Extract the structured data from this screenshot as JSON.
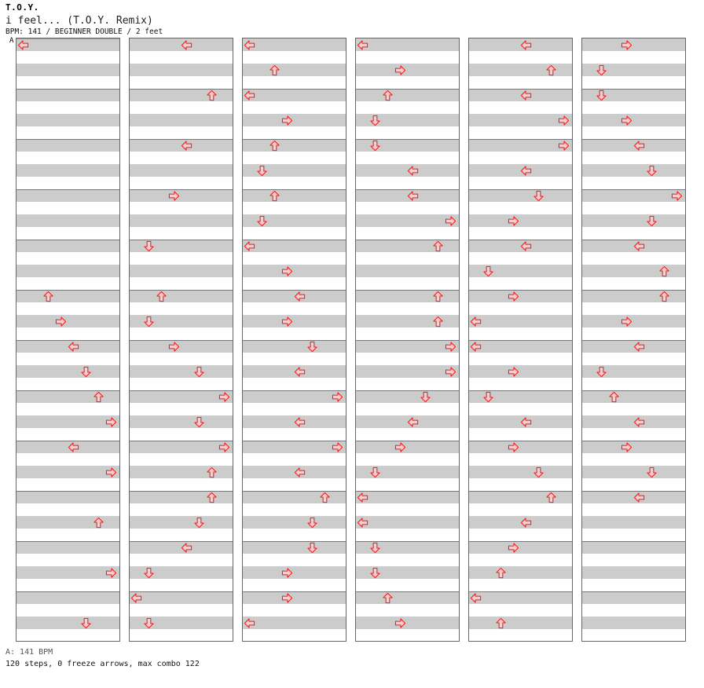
{
  "header": {
    "artist": "T.O.Y.",
    "title": "i feel... (T.O.Y. Remix)",
    "meta": "BPM: 141 / BEGINNER DOUBLE / 2 feet",
    "marker": "A"
  },
  "footer": {
    "bpm_line": "A: 141 BPM",
    "stats_line": "120 steps, 0 freeze arrows, max combo 122"
  },
  "colors": {
    "arrow_fill": "#ffcccc",
    "arrow_stroke": "#dd2222",
    "band": "#cccccc"
  },
  "chart": {
    "columns": 6,
    "lanes": 8,
    "rows_per_column": 24,
    "notes": [
      [
        [
          0,
          "L"
        ],
        [
          0,
          null
        ],
        [
          0,
          null
        ],
        [
          0,
          null
        ],
        [
          0,
          null
        ],
        [
          0,
          null
        ],
        [
          0,
          null
        ],
        [
          0,
          null
        ],
        [
          0,
          null
        ],
        [
          0,
          null
        ],
        [
          2,
          "U"
        ],
        [
          3,
          "R"
        ],
        [
          4,
          "L"
        ],
        [
          5,
          "D"
        ],
        [
          6,
          "U"
        ],
        [
          7,
          "R"
        ],
        [
          4,
          "L"
        ],
        [
          7,
          "R"
        ],
        [
          0,
          null
        ],
        [
          6,
          "U"
        ],
        [
          0,
          null
        ],
        [
          7,
          "R"
        ],
        [
          0,
          null
        ],
        [
          5,
          "D"
        ],
        [
          0,
          null
        ]
      ],
      [
        [
          4,
          "L"
        ],
        [
          0,
          null
        ],
        [
          6,
          "U"
        ],
        [
          0,
          null
        ],
        [
          4,
          "L"
        ],
        [
          0,
          null
        ],
        [
          3,
          "R"
        ],
        [
          0,
          null
        ],
        [
          1,
          "D"
        ],
        [
          0,
          null
        ],
        [
          2,
          "U"
        ],
        [
          1,
          "D"
        ],
        [
          3,
          "R"
        ],
        [
          5,
          "D"
        ],
        [
          7,
          "R"
        ],
        [
          5,
          "D"
        ],
        [
          7,
          "R"
        ],
        [
          6,
          "U"
        ],
        [
          6,
          "U"
        ],
        [
          5,
          "D"
        ],
        [
          4,
          "L"
        ],
        [
          1,
          "D"
        ],
        [
          0,
          "L"
        ],
        [
          1,
          "D"
        ]
      ],
      [
        [
          0,
          "L"
        ],
        [
          2,
          "U"
        ],
        [
          0,
          "L"
        ],
        [
          3,
          "R"
        ],
        [
          2,
          "U"
        ],
        [
          1,
          "D"
        ],
        [
          2,
          "U"
        ],
        [
          1,
          "D"
        ],
        [
          0,
          "L"
        ],
        [
          3,
          "R"
        ],
        [
          4,
          "L"
        ],
        [
          3,
          "R"
        ],
        [
          5,
          "D"
        ],
        [
          4,
          "L"
        ],
        [
          7,
          "R"
        ],
        [
          4,
          "L"
        ],
        [
          7,
          "R"
        ],
        [
          4,
          "L"
        ],
        [
          6,
          "U"
        ],
        [
          5,
          "D"
        ],
        [
          5,
          "D"
        ],
        [
          3,
          "R"
        ],
        [
          3,
          "R"
        ],
        [
          0,
          "L"
        ]
      ],
      [
        [
          0,
          "L"
        ],
        [
          3,
          "R"
        ],
        [
          2,
          "U"
        ],
        [
          1,
          "D"
        ],
        [
          1,
          "D"
        ],
        [
          4,
          "L"
        ],
        [
          4,
          "L"
        ],
        [
          7,
          "R"
        ],
        [
          6,
          "U"
        ],
        [
          0,
          null
        ],
        [
          6,
          "U"
        ],
        [
          6,
          "U"
        ],
        [
          7,
          "R"
        ],
        [
          7,
          "R"
        ],
        [
          5,
          "D"
        ],
        [
          4,
          "L"
        ],
        [
          3,
          "R"
        ],
        [
          1,
          "D"
        ],
        [
          0,
          "L"
        ],
        [
          0,
          "L"
        ],
        [
          1,
          "D"
        ],
        [
          1,
          "D"
        ],
        [
          2,
          "U"
        ],
        [
          3,
          "R"
        ]
      ],
      [
        [
          4,
          "L"
        ],
        [
          6,
          "U"
        ],
        [
          4,
          "L"
        ],
        [
          7,
          "R"
        ],
        [
          7,
          "R"
        ],
        [
          4,
          "L"
        ],
        [
          5,
          "D"
        ],
        [
          3,
          "R"
        ],
        [
          4,
          "L"
        ],
        [
          1,
          "D"
        ],
        [
          3,
          "R"
        ],
        [
          0,
          "L"
        ],
        [
          0,
          "L"
        ],
        [
          3,
          "R"
        ],
        [
          1,
          "D"
        ],
        [
          4,
          "L"
        ],
        [
          3,
          "R"
        ],
        [
          5,
          "D"
        ],
        [
          6,
          "U"
        ],
        [
          4,
          "L"
        ],
        [
          3,
          "R"
        ],
        [
          2,
          "U"
        ],
        [
          0,
          "L"
        ],
        [
          2,
          "U"
        ]
      ],
      [
        [
          3,
          "R"
        ],
        [
          1,
          "D"
        ],
        [
          1,
          "D"
        ],
        [
          3,
          "R"
        ],
        [
          4,
          "L"
        ],
        [
          5,
          "D"
        ],
        [
          7,
          "R"
        ],
        [
          5,
          "D"
        ],
        [
          4,
          "L"
        ],
        [
          6,
          "U"
        ],
        [
          6,
          "U"
        ],
        [
          3,
          "R"
        ],
        [
          4,
          "L"
        ],
        [
          1,
          "D"
        ],
        [
          2,
          "U"
        ],
        [
          4,
          "L"
        ],
        [
          3,
          "R"
        ],
        [
          5,
          "D"
        ],
        [
          4,
          "L"
        ],
        [
          0,
          null
        ],
        [
          0,
          null
        ],
        [
          0,
          null
        ],
        [
          0,
          null
        ],
        [
          0,
          null
        ]
      ]
    ]
  }
}
